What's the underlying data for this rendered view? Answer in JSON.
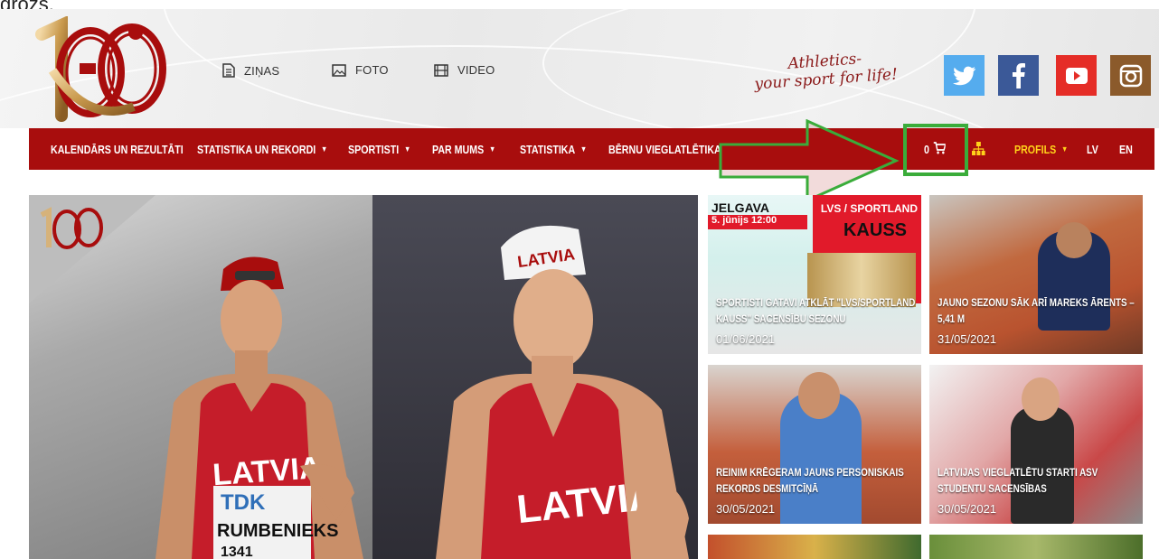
{
  "top_cut_text": "grozs.",
  "topnav": {
    "news": "ZIŅAS",
    "photo": "FOTO",
    "video": "VIDEO"
  },
  "tagline": {
    "line1": "Athletics-",
    "line2": "your sport for life!"
  },
  "social": [
    {
      "name": "twitter",
      "color": "#55acee"
    },
    {
      "name": "facebook",
      "color": "#3b5998"
    },
    {
      "name": "youtube",
      "color": "#e52d27"
    },
    {
      "name": "instagram",
      "color": "#8b5a2b"
    }
  ],
  "nav": {
    "calendar": "KALENDĀRS UN REZULTĀTI",
    "stats_records": "STATISTIKA UN REKORDI",
    "athletes": "SPORTISTI",
    "about": "PAR MUMS",
    "statistics": "STATISTIKA",
    "kids": "BĒRNU VIEGLATLĒTIKA",
    "cart_count": "0",
    "profile": "PROFILS",
    "lang_lv": "LV",
    "lang_en": "EN"
  },
  "colors": {
    "brand_red": "#a80d0d",
    "annotation_green": "#3aac3a",
    "profile_yellow": "#ffd21a"
  },
  "hero": {
    "bib_sponsor": "TDK",
    "bib_name": "RUMBENIEKS",
    "bib_number": "1341",
    "shirt_text": "LATVIA",
    "cap_text": "LATVIA"
  },
  "cards": [
    {
      "title": "SPORTISTI GATAVI ATKLĀT \"LVS/SPORTLAND KAUSS\" SACENSĪBU SEZONU",
      "date": "01/06/2021",
      "poster_city": "JELGAVA",
      "poster_date": "5. jūnijs 12:00",
      "poster_brand": "LVS / SPORTLAND",
      "poster_title": "KAUSS"
    },
    {
      "title": "JAUNO SEZONU SĀK ARĪ MAREKS ĀRENTS – 5,41 M",
      "date": "31/05/2021"
    },
    {
      "title": "REINIM KRĒGERAM JAUNS PERSONISKAIS REKORDS DESMITCĪŅĀ",
      "date": "30/05/2021"
    },
    {
      "title": "LATVIJAS VIEGLATLĒTU STARTI ASV STUDENTU SACENSĪBAS",
      "date": "30/05/2021"
    }
  ]
}
